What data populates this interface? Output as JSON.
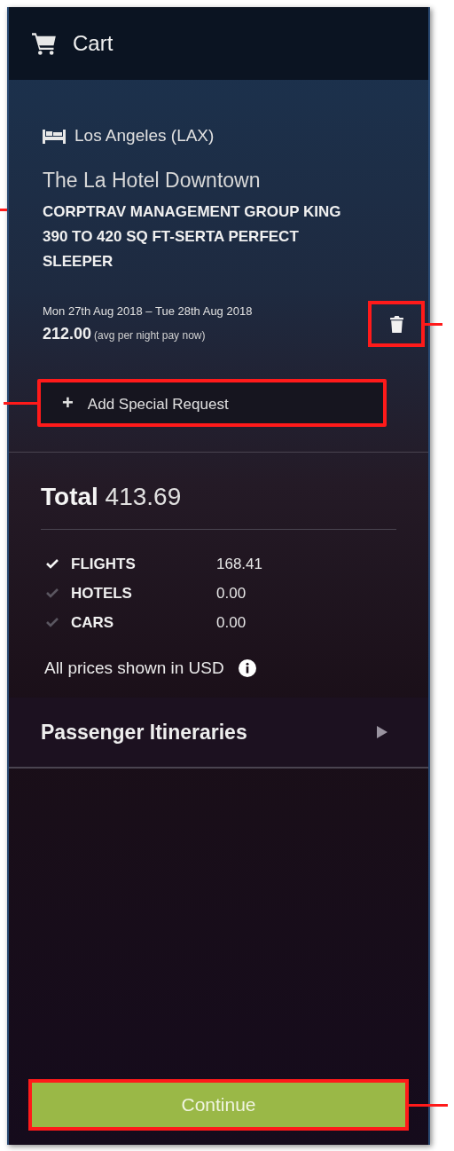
{
  "header": {
    "title": "Cart"
  },
  "hotel": {
    "location": "Los Angeles (LAX)",
    "name": "The La Hotel Downtown",
    "room": "CORPTRAV MANAGEMENT GROUP KING 390 TO 420 SQ FT-SERTA PERFECT SLEEPER",
    "dates": "Mon 27th Aug 2018 – Tue 28th Aug 2018",
    "price": "212.00",
    "price_note": "(avg per night pay now)",
    "delete_highlighted": true
  },
  "special_request": {
    "label": "Add Special Request",
    "icon": "+",
    "highlighted": true
  },
  "total": {
    "label": "Total",
    "amount": "413.69"
  },
  "breakdown": [
    {
      "label": "FLIGHTS",
      "amount": "168.41",
      "checked": true
    },
    {
      "label": "HOTELS",
      "amount": "0.00",
      "checked": false
    },
    {
      "label": "CARS",
      "amount": "0.00",
      "checked": false
    }
  ],
  "currency_note": "All prices shown in USD",
  "itineraries": {
    "label": "Passenger Itineraries",
    "expanded": false
  },
  "continue_button": {
    "label": "Continue",
    "highlighted": true
  }
}
